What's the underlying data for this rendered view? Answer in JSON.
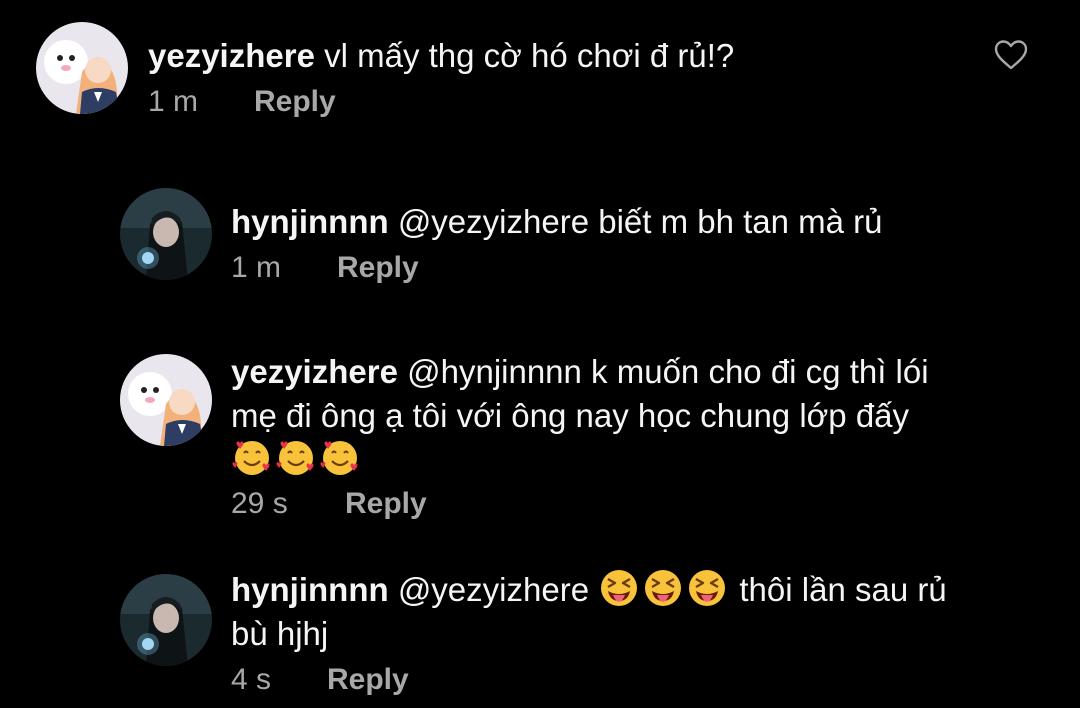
{
  "comments": [
    {
      "username": "yezyizhere",
      "lines": [
        "vl mấy thg cờ hó chơi đ rủ!?"
      ],
      "time": "1 m",
      "reply_label": "Reply"
    },
    {
      "username": "hynjinnnn",
      "lines": [
        "@yezyizhere biết m bh tan mà rủ"
      ],
      "time": "1 m",
      "reply_label": "Reply"
    },
    {
      "username": "yezyizhere",
      "lines": [
        "@hynjinnnn k muốn cho đi cg thì lói",
        "mẹ đi ông ạ tôi với ông nay học chung lớp đấy"
      ],
      "emojis": [
        "smiling-face-with-hearts-emoji",
        "smiling-face-with-hearts-emoji",
        "smiling-face-with-hearts-emoji"
      ],
      "time": "29 s",
      "reply_label": "Reply"
    },
    {
      "username": "hynjinnnn",
      "mention": "@yezyizhere",
      "emojis": [
        "squinting-face-with-tongue-emoji",
        "squinting-face-with-tongue-emoji",
        "squinting-face-with-tongue-emoji"
      ],
      "lines": [
        "thôi lần sau rủ",
        "bù hjhj"
      ],
      "time": "4 s",
      "reply_label": "Reply"
    }
  ],
  "icons": {
    "like": "heart-outline-icon"
  },
  "colors": {
    "background": "#000000",
    "text": "#f5f5f5",
    "secondary_text": "#a8a8a8"
  }
}
